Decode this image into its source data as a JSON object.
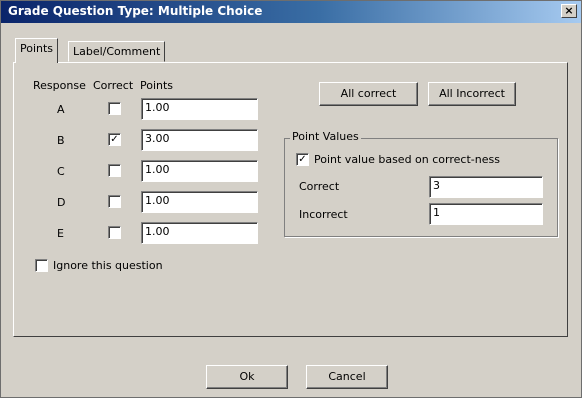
{
  "window": {
    "title": "Grade Question Type: Multiple Choice",
    "close_glyph": "×"
  },
  "tabs": [
    {
      "label": "Points",
      "active": true
    },
    {
      "label": "Label/Comment",
      "active": false
    }
  ],
  "points": {
    "headers": {
      "response": "Response",
      "correct": "Correct",
      "points": "Points"
    },
    "rows": [
      {
        "letter": "A",
        "correct": false,
        "points": "1.00"
      },
      {
        "letter": "B",
        "correct": true,
        "points": "3.00"
      },
      {
        "letter": "C",
        "correct": false,
        "points": "1.00"
      },
      {
        "letter": "D",
        "correct": false,
        "points": "1.00"
      },
      {
        "letter": "E",
        "correct": false,
        "points": "1.00"
      }
    ],
    "ignore_label": "Ignore this question",
    "ignore_checked": false
  },
  "buttons": {
    "all_correct": "All correct",
    "all_incorrect": "All Incorrect",
    "ok": "Ok",
    "cancel": "Cancel"
  },
  "point_values": {
    "group_label": "Point Values",
    "based_label": "Point value based on correct-ness",
    "based_checked": true,
    "correct_label": "Correct",
    "correct_value": "3",
    "incorrect_label": "Incorrect",
    "incorrect_value": "1"
  },
  "check_glyph": "✓"
}
